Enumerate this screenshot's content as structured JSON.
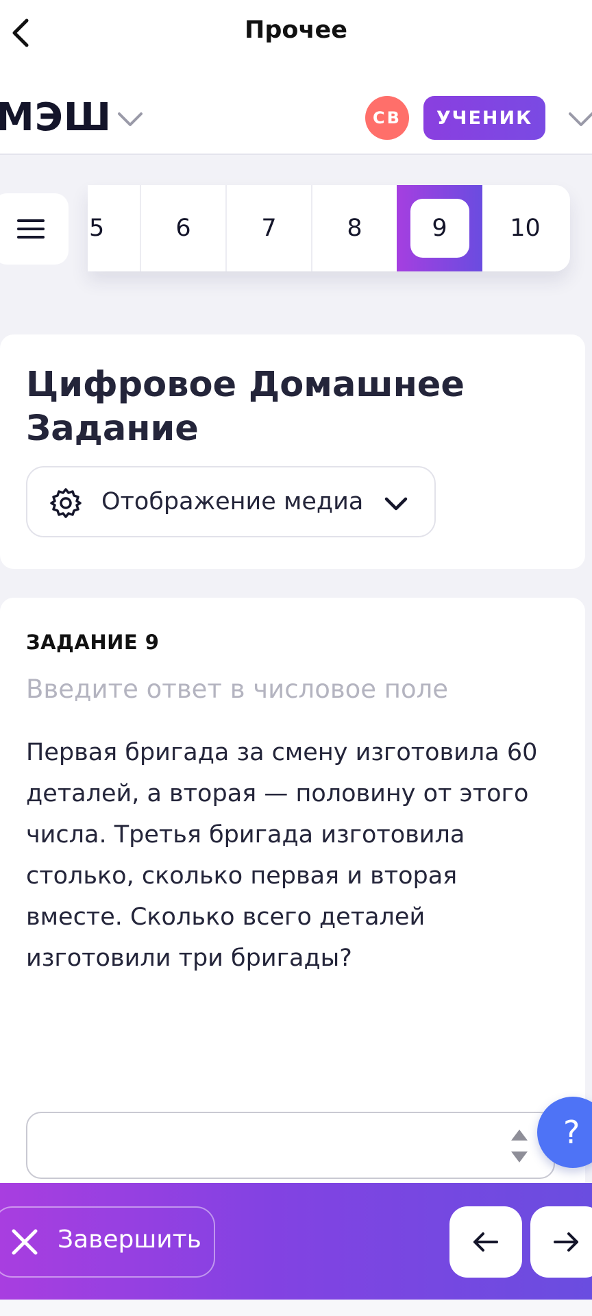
{
  "navbar": {
    "title": "Прочее"
  },
  "header": {
    "logo": "МЭШ",
    "avatar_initials": "СВ",
    "role": "УЧЕНИК"
  },
  "tasks_nav": {
    "numbers": [
      "5",
      "6",
      "7",
      "8",
      "9",
      "10"
    ],
    "active": "9"
  },
  "title_card": {
    "title": "Цифровое Домашнее Задание",
    "media_button": "Отображение медиа"
  },
  "task": {
    "heading": "ЗАДАНИЕ 9",
    "hint": "Введите ответ в числовое поле",
    "text": "Первая бригада за смену изготовила 60 деталей, а вторая — половину от этого числа. Третья бригада изготовила столько, сколько первая и вторая вместе. Сколько всего деталей изготовили три бригады?",
    "answer_value": ""
  },
  "help": {
    "label": "?"
  },
  "footer": {
    "finish_label": "Завершить"
  },
  "colors": {
    "accent_start": "#a83ee0",
    "accent_end": "#6a4de0",
    "avatar": "#ff6f6a",
    "help": "#4e73f6"
  }
}
